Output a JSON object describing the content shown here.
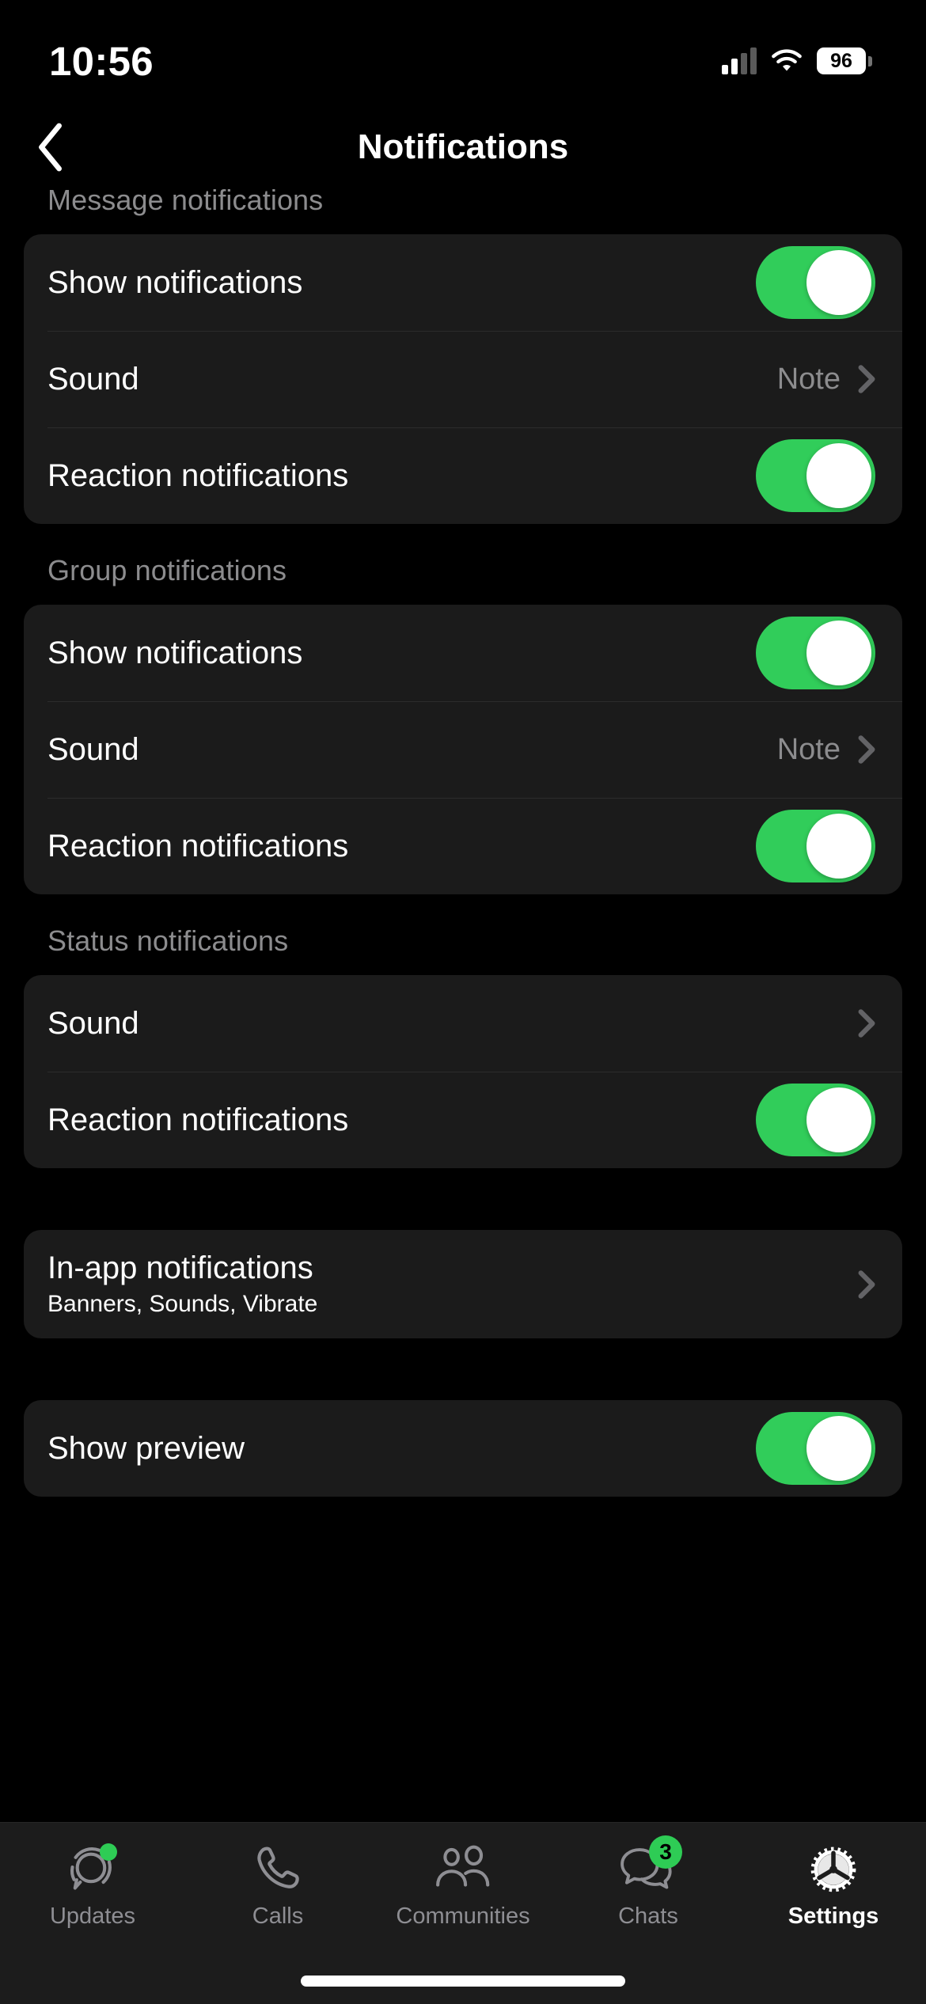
{
  "status_bar": {
    "time": "10:56",
    "battery_level": "96",
    "icons": [
      "cellular-signal-icon",
      "wifi-icon",
      "battery-icon"
    ]
  },
  "nav": {
    "title": "Notifications",
    "back_icon": "chevron-left-icon"
  },
  "colors": {
    "accent_green": "#31cd5a",
    "background": "#000000",
    "card": "#1b1b1b",
    "secondary_text": "#8c8c8e",
    "tabbar": "#1c1c1c"
  },
  "sections": [
    {
      "header": "Message notifications",
      "rows": [
        {
          "type": "toggle",
          "label": "Show notifications",
          "state": "on"
        },
        {
          "type": "value",
          "label": "Sound",
          "value": "Note",
          "chevron": true
        },
        {
          "type": "toggle",
          "label": "Reaction notifications",
          "state": "on"
        }
      ]
    },
    {
      "header": "Group notifications",
      "rows": [
        {
          "type": "toggle",
          "label": "Show notifications",
          "state": "on"
        },
        {
          "type": "value",
          "label": "Sound",
          "value": "Note",
          "chevron": true
        },
        {
          "type": "toggle",
          "label": "Reaction notifications",
          "state": "on"
        }
      ]
    },
    {
      "header": "Status notifications",
      "rows": [
        {
          "type": "value",
          "label": "Sound",
          "value": "",
          "chevron": true
        },
        {
          "type": "toggle",
          "label": "Reaction notifications",
          "state": "on"
        }
      ]
    },
    {
      "header": "",
      "rows": [
        {
          "type": "detail",
          "label": "In-app notifications",
          "subtitle": "Banners, Sounds, Vibrate",
          "chevron": true
        }
      ]
    },
    {
      "header": "",
      "rows": [
        {
          "type": "toggle",
          "label": "Show preview",
          "state": "on"
        }
      ]
    }
  ],
  "tabbar": {
    "items": [
      {
        "label": "Updates",
        "icon": "status-updates-icon",
        "active": false,
        "dot_badge": true
      },
      {
        "label": "Calls",
        "icon": "phone-icon",
        "active": false
      },
      {
        "label": "Communities",
        "icon": "communities-icon",
        "active": false
      },
      {
        "label": "Chats",
        "icon": "chat-bubbles-icon",
        "active": false,
        "badge": "3"
      },
      {
        "label": "Settings",
        "icon": "gear-icon",
        "active": true
      }
    ]
  }
}
